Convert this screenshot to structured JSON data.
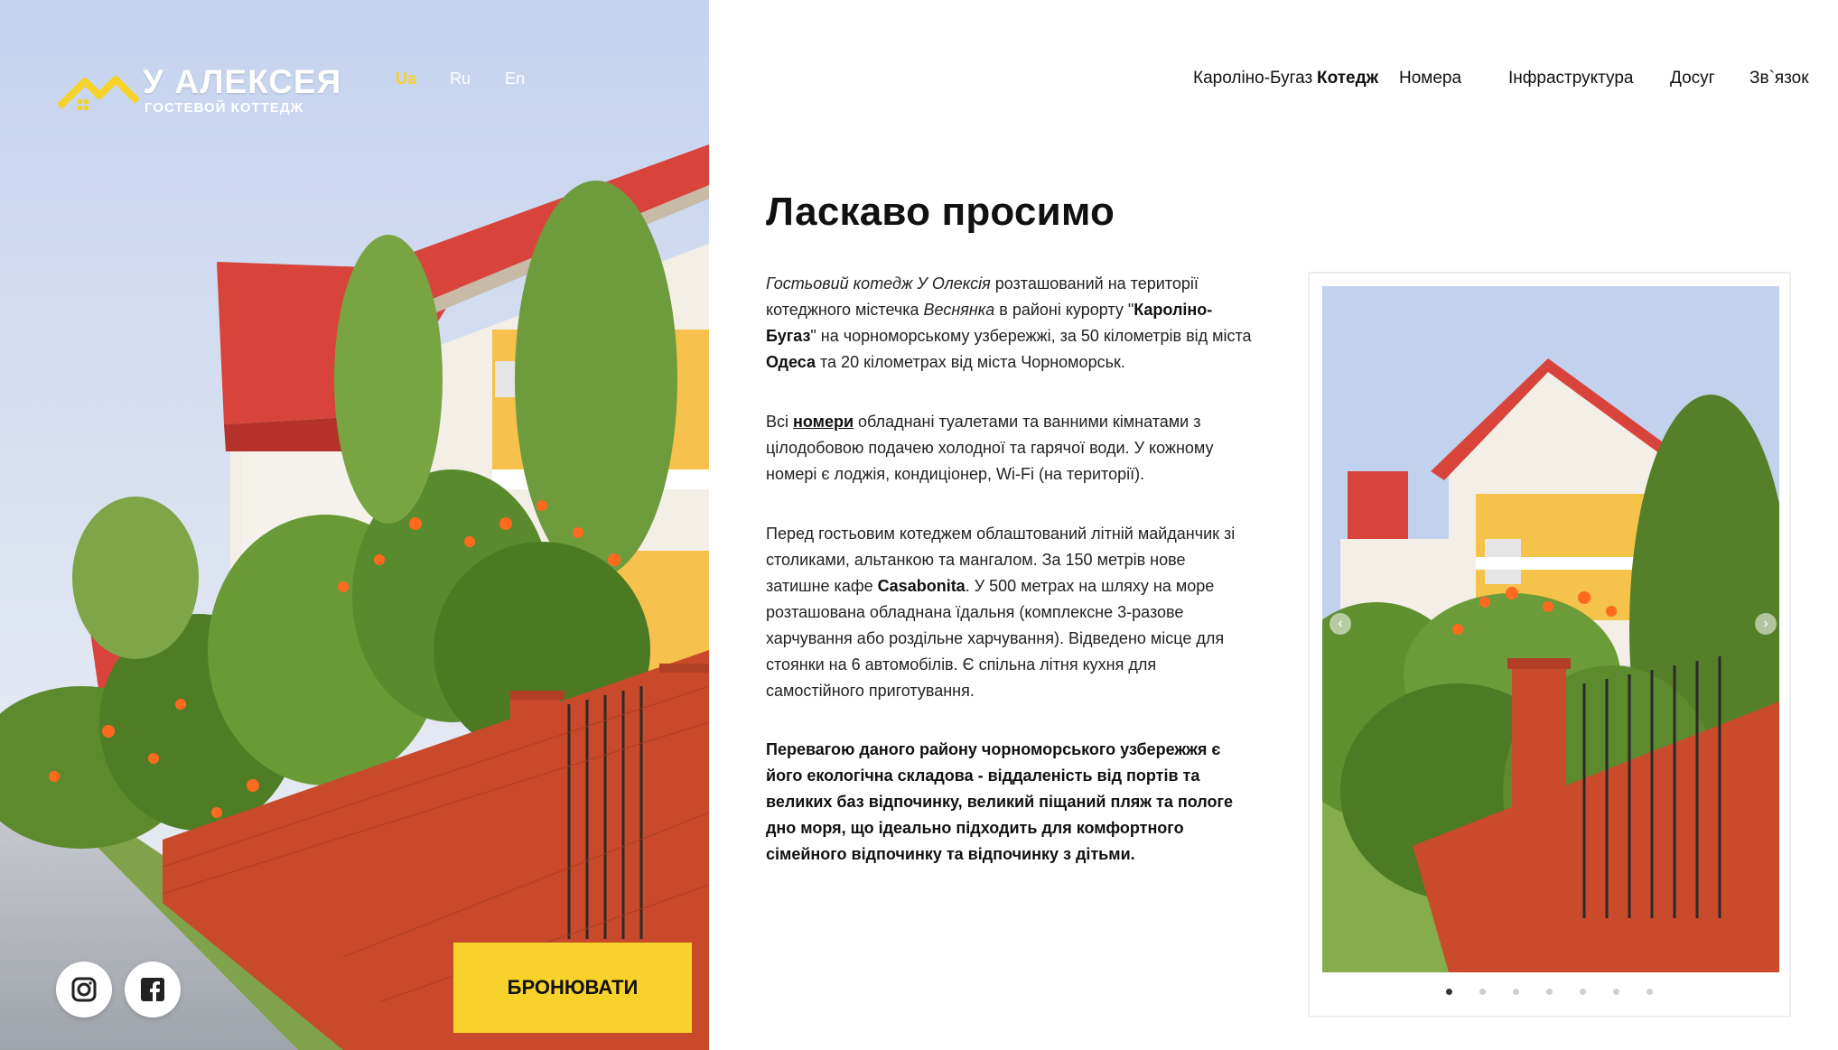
{
  "brand": {
    "title": "У АЛЕКСЕЯ",
    "subtitle": "ГОСТЕВОЙ КОТТЕДЖ",
    "accent_color": "#f6d22b"
  },
  "languages": [
    {
      "label": "Ua",
      "active": true
    },
    {
      "label": "Ru",
      "active": false
    },
    {
      "label": "En",
      "active": false
    }
  ],
  "nav": [
    {
      "label": "Кароліно-Бугаз",
      "active": false
    },
    {
      "label": "Котедж",
      "active": true
    },
    {
      "label": "Номера",
      "active": false
    },
    {
      "label": "Інфраструктура",
      "active": false
    },
    {
      "label": "Досуг",
      "active": false
    },
    {
      "label": "Зв`язок",
      "active": false
    }
  ],
  "main": {
    "heading": "Ласкаво просимо",
    "p1": {
      "italic1": "Гостьовий котедж У Олексія",
      "t1": " розташований на території котеджного містечка ",
      "italic2": "Веснянка",
      "t2": " в районі курорту \"",
      "bold1": "Кароліно-Бугаз",
      "t3": "\" на чорноморському узбережжі, за 50 кілометрів від міста ",
      "bold2": "Одеса",
      "t4": " та 20 кілометрах від міста Чорноморськ."
    },
    "p2": {
      "t1": "Всі ",
      "link": "номери",
      "t2": " обладнані туалетами та ванними кімнатами з цілодобовою подачею холодної та гарячої води. У кожному номері є лоджія, кондиціонер, Wi-Fi (на території)."
    },
    "p3": {
      "t1": "Перед гостьовим котеджем облаштований літній майданчик зі столиками, альтанкою та мангалом. За 150 метрів нове затишне кафе ",
      "bold1": "Casabonita",
      "t2": ". У 500 метрах на шляху на море розташована обладнана їдальня (комплексне 3-разове харчування або роздільне харчування). Відведено місце для стоянки на 6 автомобілів. Є спільна літня кухня для самостійного приготування."
    },
    "p4": "Перевагою даного району чорноморського узбережжя є його екологічна складова - віддаленість від портів та великих баз відпочинку, великий піщаний пляж та пологе дно моря, що ідеально підходить для комфортного сімейного відпочинку та відпочинку з дітьми."
  },
  "book_button": "БРОНЮВАТИ",
  "social": [
    {
      "icon": "instagram-icon"
    },
    {
      "icon": "facebook-icon"
    }
  ],
  "gallery": {
    "slides_total": 7,
    "active_slide": 1,
    "next_icon": "chevron-right-icon",
    "prev_icon": "chevron-left-icon"
  }
}
